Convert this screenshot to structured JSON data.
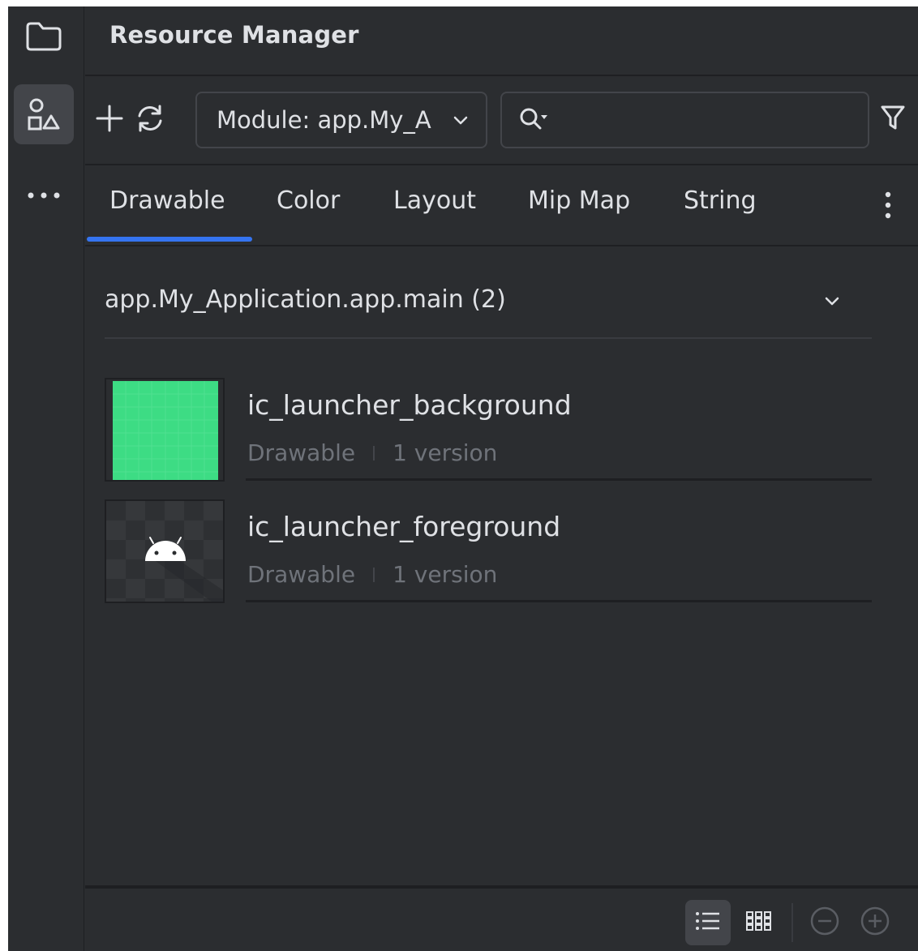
{
  "panel": {
    "title": "Resource Manager"
  },
  "rail": {
    "items": [
      {
        "icon": "folder-icon",
        "active": false
      },
      {
        "icon": "resource-shapes-icon",
        "active": true
      },
      {
        "icon": "more-horizontal-icon",
        "active": false
      }
    ]
  },
  "toolbar": {
    "add_icon": "plus-icon",
    "refresh_icon": "refresh-icon",
    "module_select": {
      "value": "Module: app.My_A"
    },
    "search": {
      "value": "",
      "placeholder": ""
    },
    "filter_icon": "filter-icon"
  },
  "tabs": {
    "items": [
      {
        "label": "Drawable",
        "selected": true
      },
      {
        "label": "Color",
        "selected": false
      },
      {
        "label": "Layout",
        "selected": false
      },
      {
        "label": "Mip Map",
        "selected": false
      },
      {
        "label": "String",
        "selected": false
      }
    ],
    "more_icon": "more-vertical-icon",
    "accent": "#3574f0"
  },
  "section": {
    "label": "app.My_Application.app.main (2)"
  },
  "resources": [
    {
      "name": "ic_launcher_background",
      "type": "Drawable",
      "versions": "1 version",
      "thumb_color": "#3ddc84"
    },
    {
      "name": "ic_launcher_foreground",
      "type": "Drawable",
      "versions": "1 version",
      "thumb_color": "#ffffff"
    }
  ],
  "bottom": {
    "list_view_icon": "list-view-icon",
    "grid_view_icon": "grid-view-icon",
    "zoom_out_icon": "zoom-out-icon",
    "zoom_in_icon": "zoom-in-icon"
  }
}
